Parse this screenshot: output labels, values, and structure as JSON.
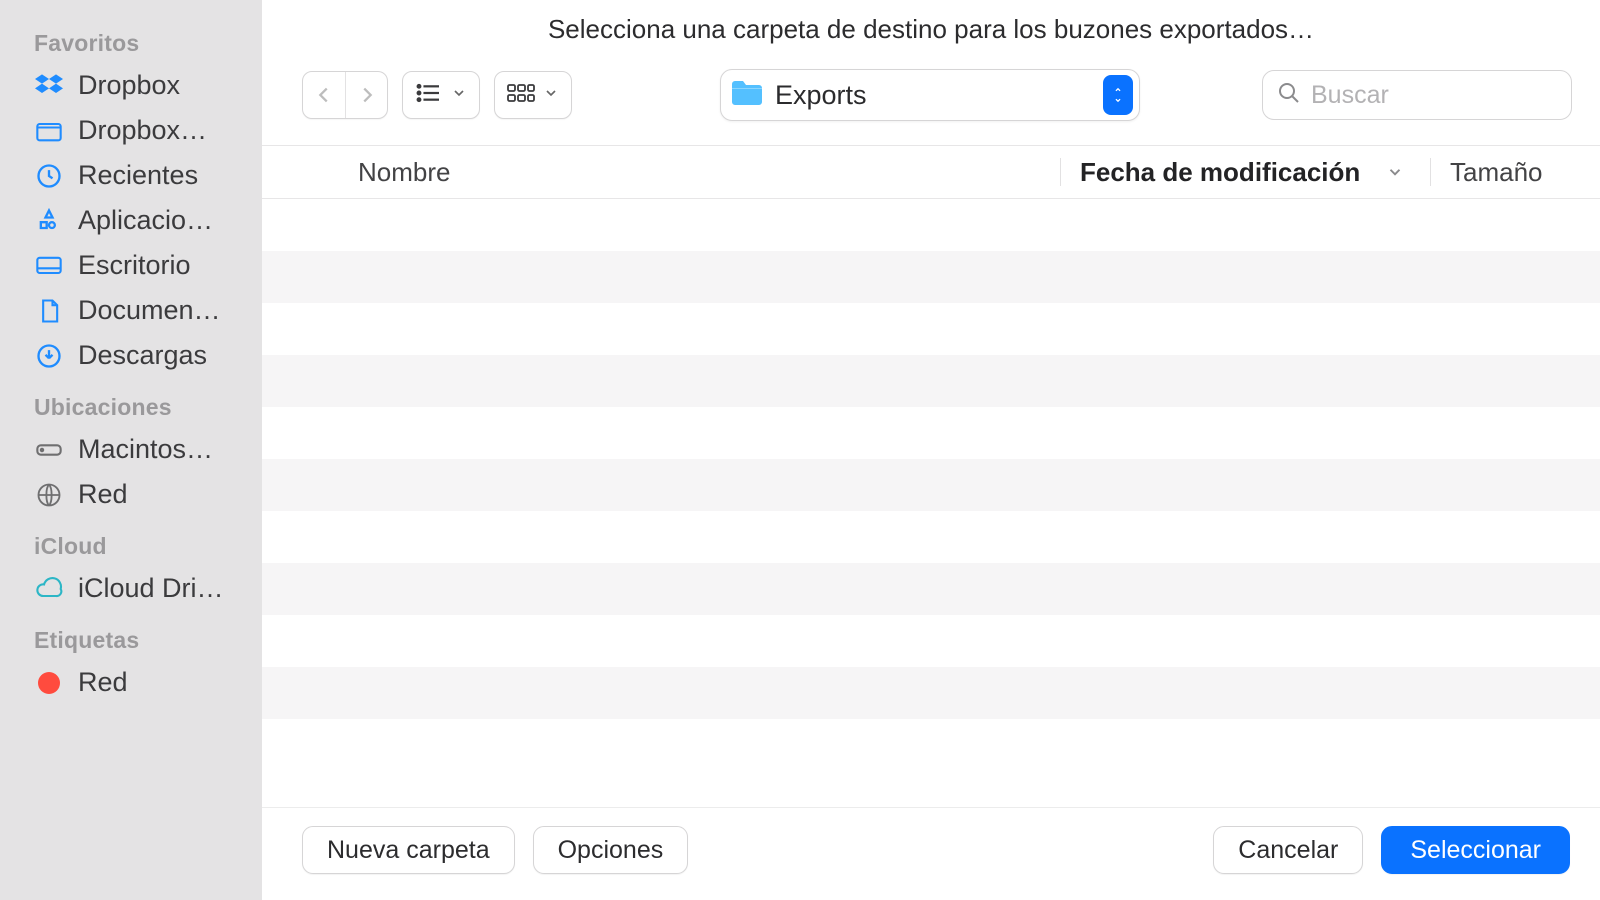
{
  "dialog_title": "Selecciona una carpeta de destino para los buzones exportados…",
  "sidebar": {
    "sections": [
      {
        "title": "Favoritos",
        "items": [
          {
            "label": "Dropbox",
            "icon": "dropbox"
          },
          {
            "label": "Dropbox…",
            "icon": "folder"
          },
          {
            "label": "Recientes",
            "icon": "clock"
          },
          {
            "label": "Aplicacio…",
            "icon": "apps"
          },
          {
            "label": "Escritorio",
            "icon": "desktop"
          },
          {
            "label": "Documen…",
            "icon": "doc"
          },
          {
            "label": "Descargas",
            "icon": "download"
          }
        ]
      },
      {
        "title": "Ubicaciones",
        "items": [
          {
            "label": "Macintos…",
            "icon": "hdd"
          },
          {
            "label": "Red",
            "icon": "globe"
          }
        ]
      },
      {
        "title": "iCloud",
        "items": [
          {
            "label": "iCloud Dri…",
            "icon": "cloud"
          }
        ]
      },
      {
        "title": "Etiquetas",
        "items": [
          {
            "label": "Red",
            "icon": "tag-red"
          }
        ]
      }
    ]
  },
  "toolbar": {
    "current_folder": "Exports"
  },
  "search": {
    "placeholder": "Buscar"
  },
  "columns": {
    "name": "Nombre",
    "modified": "Fecha de modificación",
    "size": "Tamaño"
  },
  "footer": {
    "new_folder": "Nueva carpeta",
    "options": "Opciones",
    "cancel": "Cancelar",
    "select": "Seleccionar"
  }
}
